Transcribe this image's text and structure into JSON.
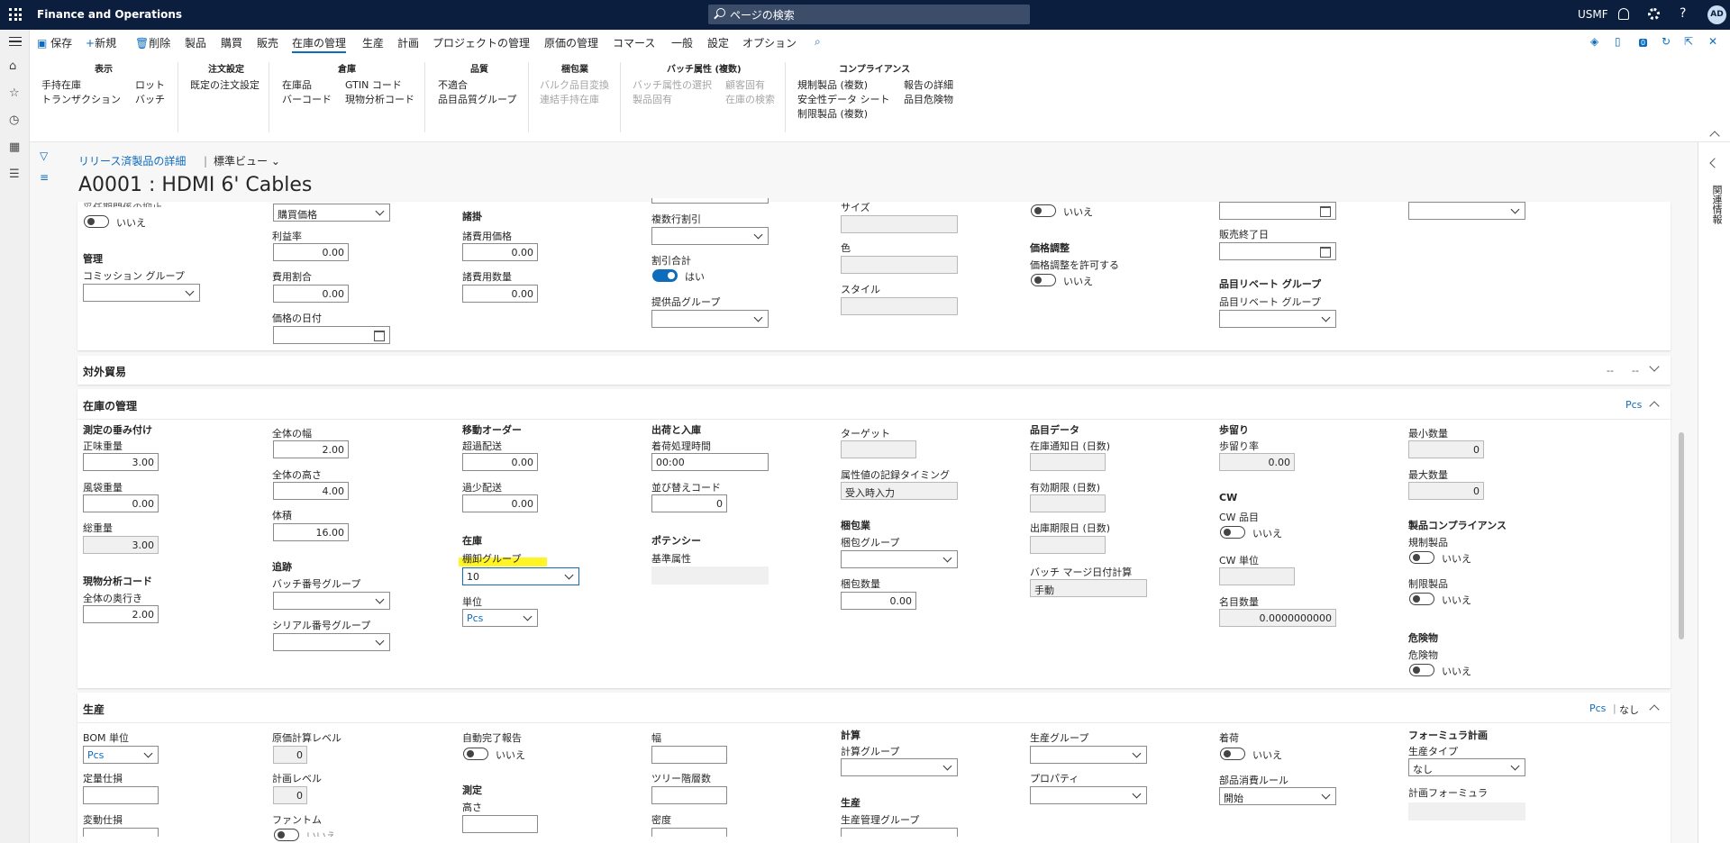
{
  "nav": {
    "app_name": "Finance and Operations",
    "search_placeholder": "ページの検索",
    "company": "USMF",
    "avatar": "AD"
  },
  "actions": {
    "save": "保存",
    "new": "新規",
    "delete": "削除",
    "tabs": [
      "製品",
      "購買",
      "販売",
      "在庫の管理",
      "生産",
      "計画",
      "プロジェクトの管理",
      "原価の管理",
      "コマース",
      "一般",
      "設定",
      "オプション"
    ],
    "selected_tab": "在庫の管理",
    "badge": "0"
  },
  "ribbon": {
    "g1": {
      "title": "表示",
      "items": [
        "手持在庫",
        "トランザクション",
        "ロット",
        "バッチ"
      ]
    },
    "g2": {
      "title": "注文設定",
      "items": [
        "既定の注文設定"
      ]
    },
    "g3": {
      "title": "倉庫",
      "items": [
        "在庫品",
        "バーコード",
        "GTIN コード",
        "現物分析コード"
      ]
    },
    "g4": {
      "title": "品質",
      "items": [
        "不適合",
        "品目品質グループ"
      ]
    },
    "g5": {
      "title": "梱包業",
      "items": [
        "バルク品目変換",
        "連結手持在庫"
      ]
    },
    "g6": {
      "title": "バッチ属性 (複数)",
      "items": [
        "バッチ属性の選択",
        "製品固有",
        "顧客固有",
        "在庫の検索"
      ]
    },
    "g7": {
      "title": "コンプライアンス",
      "items": [
        "規制製品 (複数)",
        "安全性データ シート",
        "制限製品 (複数)",
        "報告の詳細",
        "品目危険物"
      ]
    }
  },
  "right_rail": "関連情報",
  "breadcrumb": {
    "link": "リリース済製品の詳細",
    "sep": "|",
    "view": "標準ビュー"
  },
  "page_title": "A0001 : HDMI 6' Cables",
  "top": {
    "c1": {
      "trunc_label": "妥任期間係の抑止",
      "toggle1": "いいえ",
      "grp": "管理",
      "commission": "コミッション グループ"
    },
    "c2": {
      "dd_value": "購買価格",
      "profit": "利益率",
      "profit_val": "0.00",
      "cost_pct": "費用割合",
      "cost_pct_val": "0.00",
      "price_date": "価格の日付"
    },
    "c3": {
      "grp": "諸掛",
      "misc_price": "諸費用価格",
      "misc_price_val": "0.00",
      "misc_qty": "諸費用数量",
      "misc_qty_val": "0.00"
    },
    "c4": {
      "multi_disc": "複数行割引",
      "total_disc": "割引合計",
      "total_disc_val": "はい",
      "supply_grp": "提供品グループ"
    },
    "c5": {
      "size": "サイズ",
      "color": "色",
      "style": "スタイル"
    },
    "c6": {
      "toggle1": "いいえ",
      "grp": "価格調整",
      "allow": "価格調整を許可する",
      "allow_val": "いいえ"
    },
    "c7": {
      "sale_end": "販売終了日",
      "rebate_grp": "品目リベート グループ",
      "rebate": "品目リベート グループ"
    }
  },
  "foreign": {
    "title": "対外貿易",
    "a": "--",
    "b": "--"
  },
  "inv": {
    "title": "在庫の管理",
    "unit": "Pcs",
    "c1": {
      "grp": "測定の垂み付け",
      "net": "正味重量",
      "net_val": "3.00",
      "tare": "風袋重量",
      "tare_val": "0.00",
      "gross": "総重量",
      "gross_val": "3.00",
      "grp2": "現物分析コード",
      "depth": "全体の奥行き",
      "depth_val": "2.00"
    },
    "c2": {
      "width": "全体の幅",
      "width_val": "2.00",
      "height": "全体の高さ",
      "height_val": "4.00",
      "volume": "体積",
      "volume_val": "16.00",
      "grp": "追跡",
      "batch": "バッチ番号グループ",
      "serial": "シリアル番号グループ"
    },
    "c3": {
      "grp": "移動オーダー",
      "over": "超過配送",
      "over_val": "0.00",
      "under": "過少配送",
      "under_val": "0.00",
      "grp2": "在庫",
      "shelf": "棚卸グループ",
      "shelf_val": "10",
      "unit": "単位",
      "unit_val": "Pcs"
    },
    "c4": {
      "grp": "出荷と入庫",
      "arrival": "着荷処理時間",
      "arrival_val": "00:00",
      "sort": "並び替えコード",
      "sort_val": "0",
      "grp2": "ポテンシー",
      "base": "基準属性"
    },
    "c5": {
      "target": "ターゲット",
      "timing": "属性値の記録タイミング",
      "timing_val": "受入時入力",
      "grp": "梱包業",
      "pack_grp": "梱包グループ",
      "pack_qty": "梱包数量",
      "pack_qty_val": "0.00"
    },
    "c6": {
      "grp": "品目データ",
      "notice": "在庫通知日 (日数)",
      "expiry": "有効期限 (日数)",
      "shipexp": "出庫期限日 (日数)",
      "merge": "バッチ マージ日付計算",
      "merge_val": "手動"
    },
    "c7": {
      "grp": "歩留り",
      "rate": "歩留り率",
      "rate_val": "0.00",
      "grp2": "CW",
      "cw_item": "CW 品目",
      "cw_item_val": "いいえ",
      "cw_unit": "CW 単位",
      "nominal": "名目数量",
      "nominal_val": "0.0000000000"
    },
    "c8": {
      "min": "最小数量",
      "min_val": "0",
      "max": "最大数量",
      "max_val": "0",
      "grp": "製品コンプライアンス",
      "reg": "規制製品",
      "reg_val": "いいえ",
      "res": "制限製品",
      "res_val": "いいえ",
      "grp2": "危険物",
      "haz": "危険物",
      "haz_val": "いいえ"
    }
  },
  "prod": {
    "title": "生産",
    "unit": "Pcs",
    "sep": "|",
    "none": "なし",
    "c1": {
      "bom": "BOM 単位",
      "bom_val": "Pcs",
      "fixed": "定量仕損",
      "var": "変動仕損"
    },
    "c2": {
      "cost_level": "原価計算レベル",
      "cost_level_val": "0",
      "plan_level": "計画レベル",
      "plan_level_val": "0",
      "phantom": "ファントム",
      "phantom_val": "いいえ"
    },
    "c3": {
      "auto": "自動完了報告",
      "auto_val": "いいえ",
      "grp": "測定",
      "height": "高さ"
    },
    "c4": {
      "width": "幅",
      "tree": "ツリー階層数",
      "density": "密度"
    },
    "c5": {
      "grp": "計算",
      "calc_grp": "計算グループ",
      "grp2": "生産",
      "mgmt": "生産管理グループ"
    },
    "c6": {
      "pgrp": "生産グループ",
      "prop": "プロパティ"
    },
    "c7": {
      "pick": "着荷",
      "pick_val": "いいえ",
      "consume": "部品消費ルール",
      "consume_val": "開始"
    },
    "c8": {
      "grp": "フォーミュラ計画",
      "ptype": "生産タイプ",
      "ptype_val": "なし",
      "formula": "計画フォーミュラ"
    }
  }
}
